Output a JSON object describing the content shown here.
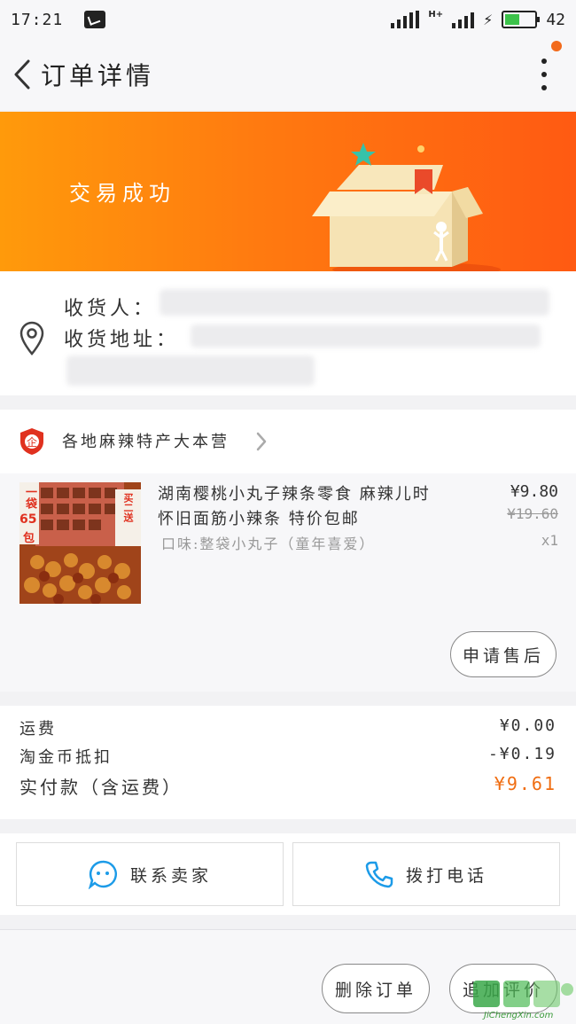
{
  "status_bar": {
    "time": "17:21",
    "battery_level": "42"
  },
  "nav": {
    "title": "订单详情"
  },
  "banner": {
    "status_text": "交易成功"
  },
  "address": {
    "receiver_label": "收货人：",
    "address_label": "收货地址："
  },
  "store": {
    "name": "各地麻辣特产大本营"
  },
  "product": {
    "title": "湖南樱桃小丸子辣条零食 麻辣儿时怀旧面筋小辣条 特价包邮",
    "variant": "口味:整袋小丸子（童年喜爱）",
    "price": "¥9.80",
    "original_price": "¥19.60",
    "quantity": "x1",
    "thumb_tag_1": "一袋",
    "thumb_tag_2": "65",
    "thumb_tag_3": "包",
    "thumb_tag_4": "买二送",
    "after_sale_label": "申请售后"
  },
  "fees": [
    {
      "label": "运费",
      "value": "¥0.00"
    },
    {
      "label": "淘金币抵扣",
      "value": "-¥0.19"
    },
    {
      "label": "实付款（含运费）",
      "value": "¥9.61"
    }
  ],
  "actions": {
    "contact_seller": "联系卖家",
    "call_phone": "拨打电话"
  },
  "footer": {
    "delete_order": "删除订单",
    "review": "追加评价",
    "watermark_text": "JiChengXin.com"
  },
  "colors": {
    "accent": "#ff7a10",
    "price_total": "#f06d11",
    "icon_blue": "#1c9be8"
  }
}
